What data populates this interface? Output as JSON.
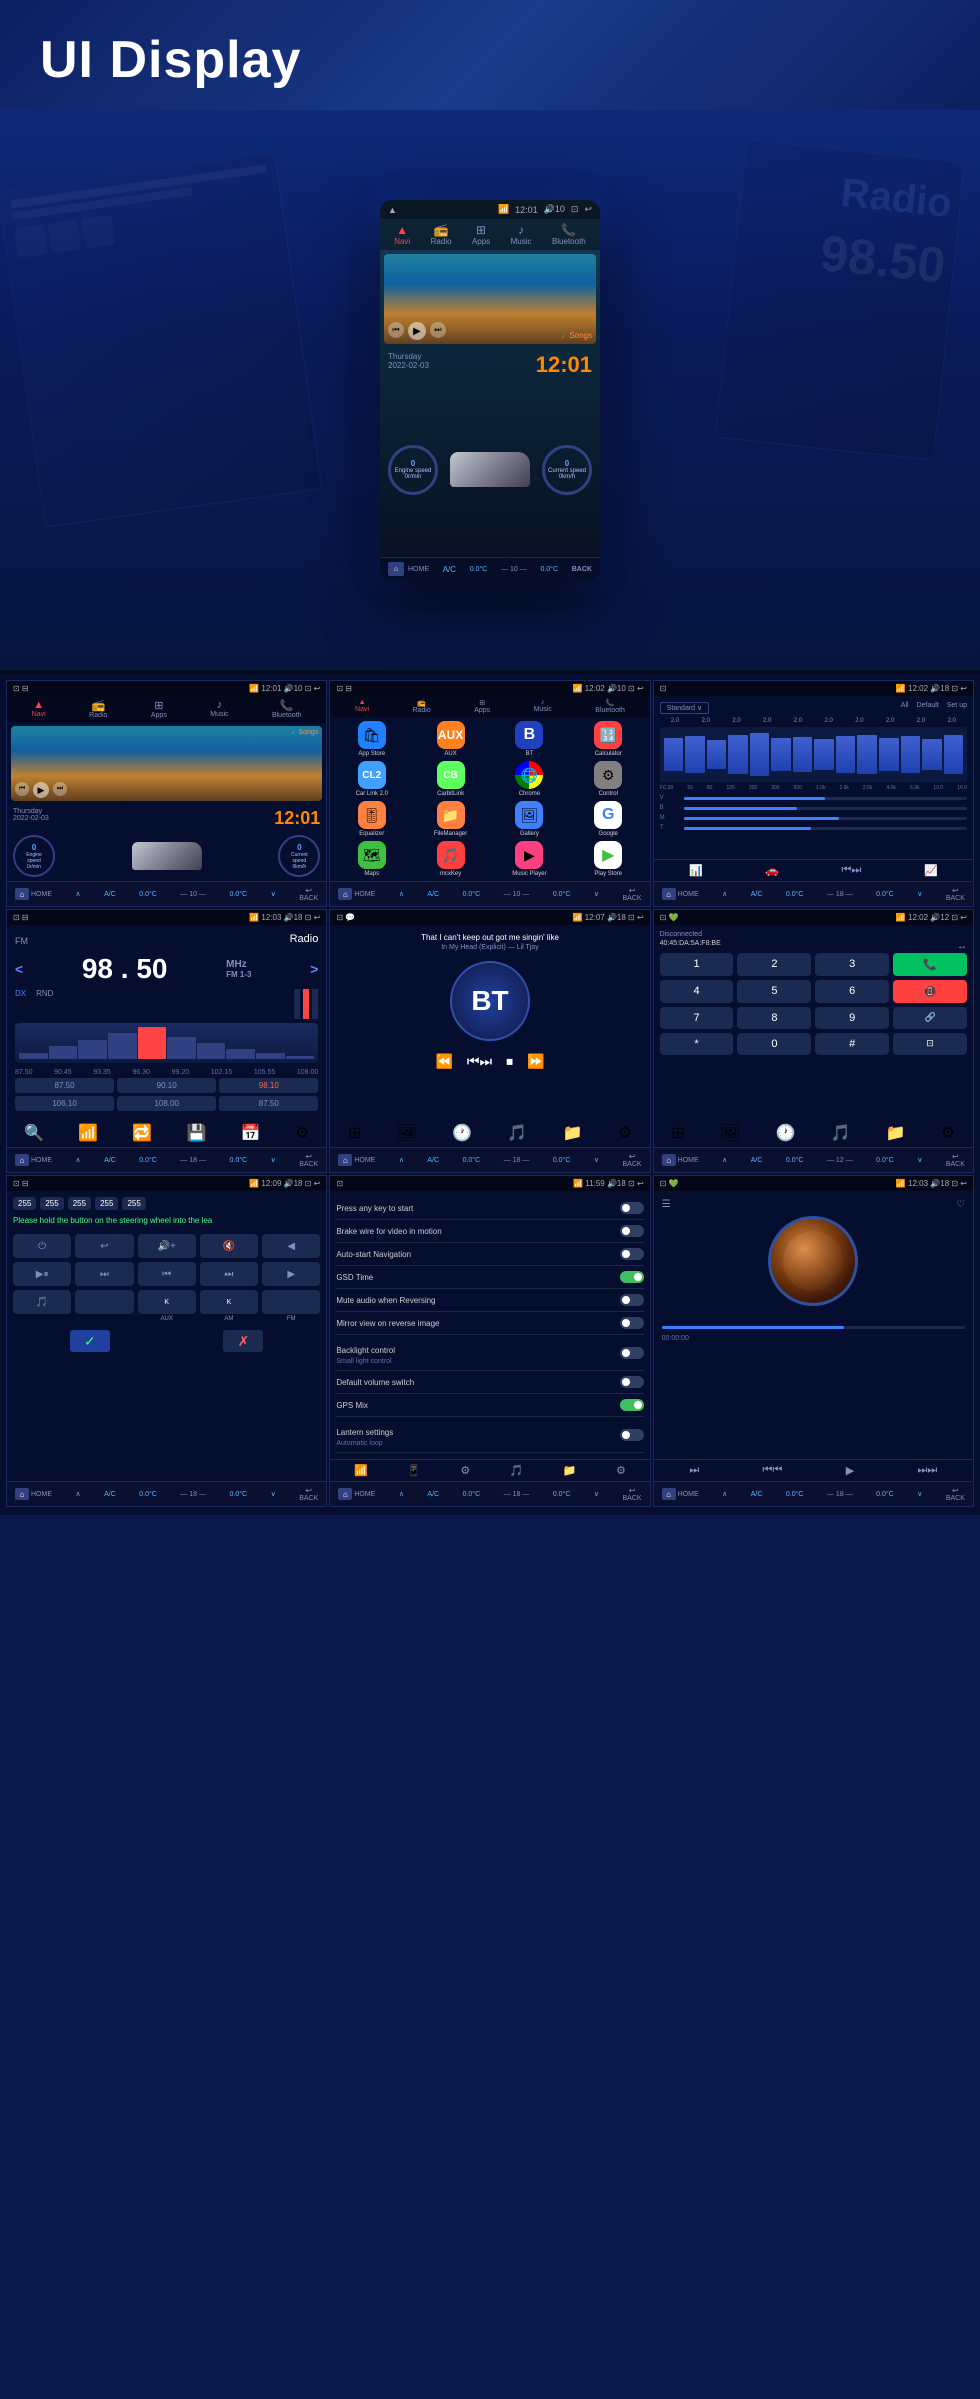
{
  "header": {
    "title": "UI Display"
  },
  "hero": {
    "nav_items": [
      {
        "label": "Navi",
        "icon": "▲",
        "active": true
      },
      {
        "label": "Radio",
        "icon": "📻"
      },
      {
        "label": "Apps",
        "icon": "⊞"
      },
      {
        "label": "Music",
        "icon": "♪"
      },
      {
        "label": "Bluetooth",
        "icon": "📞"
      }
    ],
    "time": "12:01",
    "date": "Thursday\n2022-02-03",
    "clock_display": "12:01",
    "back_label": "BACK",
    "home_label": "HOME",
    "ac_label": "0.0°C",
    "engine_speed": "0r/min",
    "current_speed": "0km/h"
  },
  "panels": {
    "row1": {
      "panel1": {
        "type": "home",
        "time": "12:01",
        "date": "Thursday\n2022-02-03",
        "music_label": "♩Songs",
        "ac": "0.0°C",
        "home": "HOME",
        "back": "BACK",
        "engine_speed": "0r/min",
        "current_speed": "0km/h"
      },
      "panel2": {
        "type": "apps",
        "apps": [
          {
            "name": "App Store",
            "color": "#2080ff",
            "icon": "🛍"
          },
          {
            "name": "AUX",
            "color": "#ff8020",
            "icon": "🔌"
          },
          {
            "name": "BT",
            "color": "#2040c0",
            "icon": "B"
          },
          {
            "name": "Calculator",
            "color": "#ff4040",
            "icon": "🔢"
          },
          {
            "name": "Car Link 2.0",
            "color": "#40a0ff",
            "icon": "🚗"
          },
          {
            "name": "CarbitLink",
            "color": "#40c040",
            "icon": "🔗"
          },
          {
            "name": "Chrome",
            "color": "#e0e0e0",
            "icon": "🌐"
          },
          {
            "name": "Control",
            "color": "#808080",
            "icon": "⚙"
          },
          {
            "name": "Equalizer",
            "color": "#ff8040",
            "icon": "🎚"
          },
          {
            "name": "FileManager",
            "color": "#ff8040",
            "icon": "📁"
          },
          {
            "name": "Gallery",
            "color": "#4080ff",
            "icon": "🖼"
          },
          {
            "name": "Google",
            "color": "#e0e0e0",
            "icon": "G"
          },
          {
            "name": "Maps",
            "color": "#40c040",
            "icon": "🗺"
          },
          {
            "name": "mcxKey",
            "color": "#ff4040",
            "icon": "🎵"
          },
          {
            "name": "Music Player",
            "color": "#ff4080",
            "icon": "🎵"
          },
          {
            "name": "Play Store",
            "color": "#e0e0e0",
            "icon": "▶"
          }
        ]
      },
      "panel3": {
        "type": "equalizer",
        "title": "Standard",
        "options": [
          "All",
          "Default",
          "Set up"
        ],
        "freq_labels": [
          "2.0",
          "2.0",
          "2.0",
          "2.0",
          "2.0",
          "2.0",
          "2.0",
          "2.0",
          "2.0",
          "2.0"
        ],
        "freq_bottom": [
          "FC: 30",
          "50",
          "80",
          "125",
          "200",
          "300",
          "500",
          "1.0k",
          "1.6k",
          "2.5k",
          "4.0k",
          "6.3k",
          "10.0",
          "16.0"
        ],
        "bars_heights": [
          30,
          40,
          35,
          45,
          50,
          38,
          42,
          35,
          40,
          45,
          38,
          42,
          36,
          44
        ]
      }
    },
    "row2": {
      "panel4": {
        "type": "radio",
        "fm_label": "FM",
        "title": "Radio",
        "freq": "98.50",
        "freq_band": "FM 1-3",
        "unit": "MHz",
        "dx_label": "DX",
        "rnd_label": "RND",
        "scale_start": "87.50",
        "scale_end": "108.00",
        "markers": [
          "87.50",
          "90.45",
          "93.35",
          "96.30",
          "99.20",
          "102.15",
          "105.55",
          "108.00"
        ],
        "presets": [
          "87.50",
          "90.10",
          "98.10",
          "106.10",
          "108.00",
          "87.50"
        ],
        "ac": "0.0°C",
        "home": "HOME",
        "back": "BACK"
      },
      "panel5": {
        "type": "bt_music",
        "song": "That I can't keep out got me singin' like",
        "artist": "In My Head (Explicit) — Lil Tjay",
        "bt_label": "BT",
        "ac": "0.0°C",
        "home": "HOME",
        "back": "BACK"
      },
      "panel6": {
        "type": "dialer",
        "status": "Disconnected",
        "address": "40:45:DA:5A:F8:BE",
        "keys": [
          "1",
          "2",
          "3",
          "📞",
          "4",
          "5",
          "6",
          "📵",
          "7",
          "8",
          "9",
          "🔗",
          "*",
          "0",
          "#",
          "⬛"
        ],
        "ac": "0.0°C",
        "home": "HOME",
        "back": "BACK"
      }
    },
    "row3": {
      "panel7": {
        "type": "steering_wheel",
        "values": [
          "255",
          "255",
          "255",
          "255",
          "255"
        ],
        "message": "Please hold the button on the steering wheel into the lea",
        "buttons_row1": [
          "⏻",
          "↩",
          "🔊",
          "🔇",
          "◀"
        ],
        "buttons_row2": [
          "◀▶",
          "⏭",
          "⏮",
          "⏭",
          "▶"
        ],
        "buttons_row3": [
          "🎵",
          "",
          "K",
          "K",
          ""
        ],
        "labels_row3": [
          "",
          "",
          "AUX",
          "AM",
          "FM"
        ],
        "confirm_ok": "✓",
        "confirm_cancel": "✗",
        "ac": "0.0°C",
        "home": "HOME",
        "back": "BACK"
      },
      "panel8": {
        "type": "settings",
        "items": [
          {
            "label": "Press any key to start",
            "toggle": false
          },
          {
            "label": "Brake wire for video in motion",
            "toggle": false
          },
          {
            "label": "Auto-start Navigation",
            "toggle": false
          },
          {
            "label": "GSD Time",
            "toggle": true
          },
          {
            "label": "Mute audio when Reversing",
            "toggle": false
          },
          {
            "label": "Mirror view on reverse image",
            "toggle": false
          },
          {
            "label": "Backlight control",
            "sub": "Small light control",
            "toggle": false
          },
          {
            "label": "Default volume switch",
            "toggle": false
          },
          {
            "label": "GPS Mix",
            "toggle": true
          },
          {
            "label": "Lantern settings",
            "sub": "Automatic loop",
            "toggle": false
          }
        ],
        "ac": "0.0°C",
        "home": "HOME",
        "back": "BACK"
      },
      "panel9": {
        "type": "music_player",
        "time": "00:00:00",
        "ac": "0.0°C",
        "home": "HOME",
        "back": "BACK"
      }
    }
  },
  "bottom_bar": {
    "home": "HOME",
    "ac_left": "0.0°C",
    "ac_right": "0.0°C",
    "number": "18",
    "back": "back"
  }
}
